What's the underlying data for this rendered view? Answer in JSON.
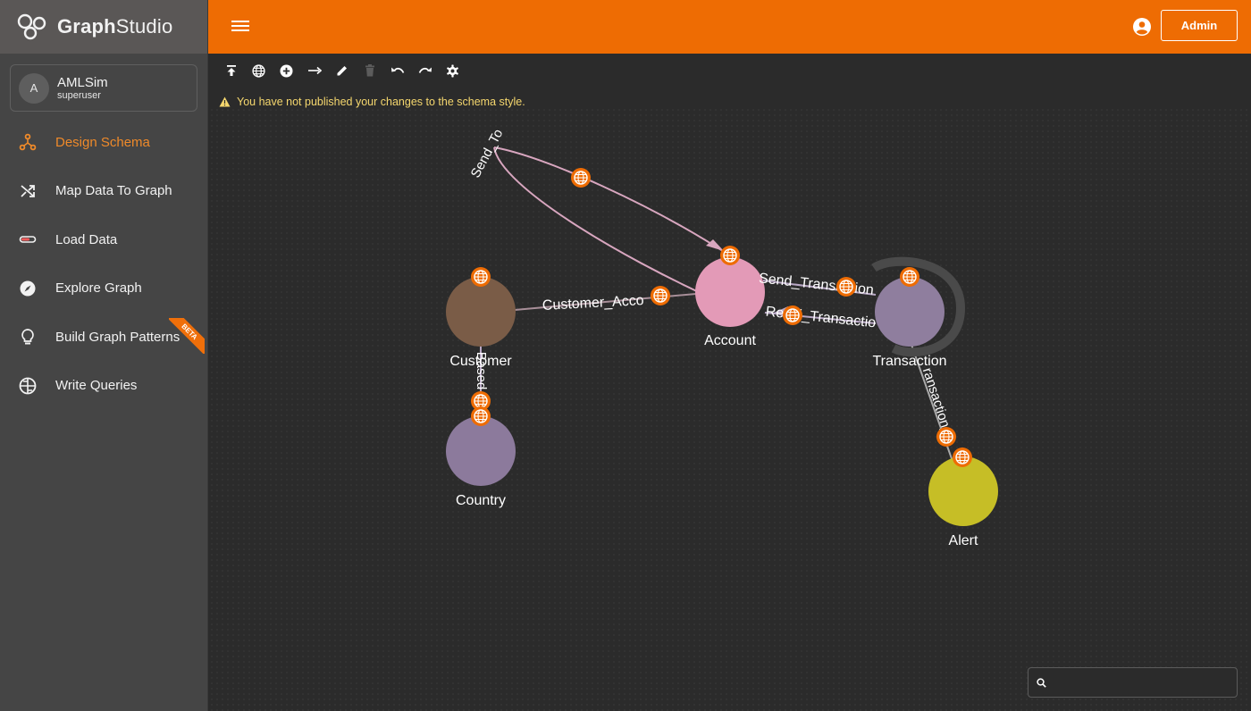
{
  "app": {
    "logo_graph": "Graph",
    "logo_studio": "Studio"
  },
  "user": {
    "initial": "A",
    "name": "AMLSim",
    "role": "superuser"
  },
  "nav": [
    {
      "label": "Design Schema",
      "icon": "schema-icon",
      "active": true
    },
    {
      "label": "Map Data To Graph",
      "icon": "shuffle-icon"
    },
    {
      "label": "Load Data",
      "icon": "load-bar-icon"
    },
    {
      "label": "Explore Graph",
      "icon": "compass-icon"
    },
    {
      "label": "Build Graph Patterns",
      "icon": "lightbulb-icon",
      "badge": "BETA"
    },
    {
      "label": "Write Queries",
      "icon": "globe-grid-icon"
    }
  ],
  "header": {
    "admin_label": "Admin"
  },
  "toolbar": {
    "tools": [
      "publish-icon",
      "globe-icon",
      "add-vertex-icon",
      "add-edge-icon",
      "edit-icon",
      "delete-icon",
      "undo-icon",
      "redo-icon",
      "settings-icon"
    ]
  },
  "warning": {
    "text": "You have not published your changes to the schema style."
  },
  "graph": {
    "vertices": [
      {
        "label": "Account",
        "color": "#e39ab7"
      },
      {
        "label": "Customer",
        "color": "#7a5c47"
      },
      {
        "label": "Transaction",
        "color": "#8f7e9e"
      },
      {
        "label": "Country",
        "color": "#8c7a9c"
      },
      {
        "label": "Alert",
        "color": "#c6be26"
      }
    ],
    "edges": [
      {
        "label": "Send_To"
      },
      {
        "label": "Customer_Acco"
      },
      {
        "label": "Send_Transaction"
      },
      {
        "label": "Recei_Transactio"
      },
      {
        "label": "Based"
      },
      {
        "label": "ransaction_F"
      }
    ]
  },
  "search": {
    "placeholder": "",
    "value": ""
  },
  "colors": {
    "accent": "#ee6c03",
    "sidebar": "#454545",
    "canvas": "#2b2b2b",
    "active_nav": "#ef8a2a"
  }
}
